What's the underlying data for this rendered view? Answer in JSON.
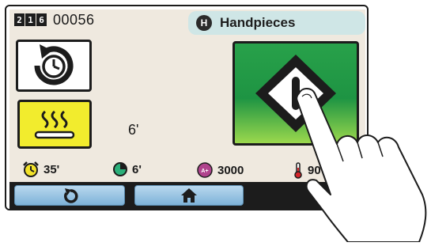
{
  "header": {
    "counter_digits": [
      "2",
      "1",
      "6"
    ],
    "cycle_count": "00056",
    "program": {
      "badge": "H",
      "name": "Handpieces"
    }
  },
  "tiles": {
    "cycle_icon": "cycle-timer-icon",
    "heat_icon": "heat-waves-icon",
    "drying_time": "6'"
  },
  "start_button": {
    "icon": "start-diamond-icon"
  },
  "stats": {
    "alarm": {
      "icon": "alarm-clock-icon",
      "value": "35'"
    },
    "timer": {
      "icon": "pie-timer-icon",
      "value": "6'"
    },
    "speed": {
      "icon": "speed-badge-icon",
      "badge": "A+",
      "value": "3000"
    },
    "temperature": {
      "icon": "thermometer-icon",
      "value": "90°C"
    }
  },
  "nav": {
    "back_icon": "back-arrow-icon",
    "home_icon": "home-icon"
  },
  "colors": {
    "screen_bg": "#efe9df",
    "header_tab": "#cfe6e6",
    "start_green": "#1e9443",
    "heat_yellow": "#f2ec2d",
    "nav_button": "#7db2d8"
  }
}
